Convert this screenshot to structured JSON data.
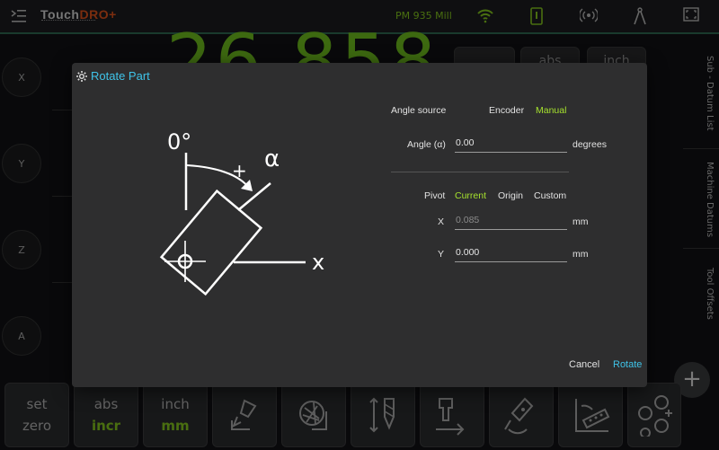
{
  "topbar": {
    "logo_main": "Touch",
    "logo_accent": "DRO",
    "logo_plus": "+",
    "machine_name": "PM 935 Mill",
    "icons": [
      "menu-icon",
      "wifi-icon",
      "tablet-icon",
      "broadcast-icon",
      "compass-icon",
      "fullscreen-icon"
    ]
  },
  "background": {
    "dro_value": "26.858",
    "top_chips": [
      "",
      "abs",
      "inch"
    ],
    "axes": [
      "X",
      "Y",
      "Z",
      "A"
    ],
    "side_tabs": [
      "Sub - Datum List",
      "Machine Datums",
      "Tool Offsets"
    ],
    "fab_label": "+"
  },
  "bottom_bar": {
    "set_zero": {
      "line1": "set",
      "line2": "zero"
    },
    "abs_incr": {
      "line1": "abs",
      "line2": "incr"
    },
    "inch_mm": {
      "line1": "inch",
      "line2": "mm"
    }
  },
  "dialog": {
    "title": "Rotate Part",
    "diagram": {
      "zero_label": "0°",
      "plus_label": "+",
      "alpha_label": "α",
      "x_label": "x"
    },
    "angle_source": {
      "label": "Angle source",
      "options": [
        "Encoder",
        "Manual"
      ],
      "selected": "Manual"
    },
    "angle": {
      "label": "Angle (α)",
      "value": "0.00",
      "unit": "degrees"
    },
    "pivot": {
      "label": "Pivot",
      "options": [
        "Current",
        "Origin",
        "Custom"
      ],
      "selected": "Current"
    },
    "pivot_x": {
      "label": "X",
      "placeholder": "0.085",
      "unit": "mm"
    },
    "pivot_y": {
      "label": "Y",
      "value": "0.000",
      "unit": "mm"
    },
    "cancel_label": "Cancel",
    "rotate_label": "Rotate"
  },
  "colors": {
    "accent_cyan": "#3fc3e8",
    "accent_green": "#86c91e",
    "selected_option": "#a6e22e"
  }
}
